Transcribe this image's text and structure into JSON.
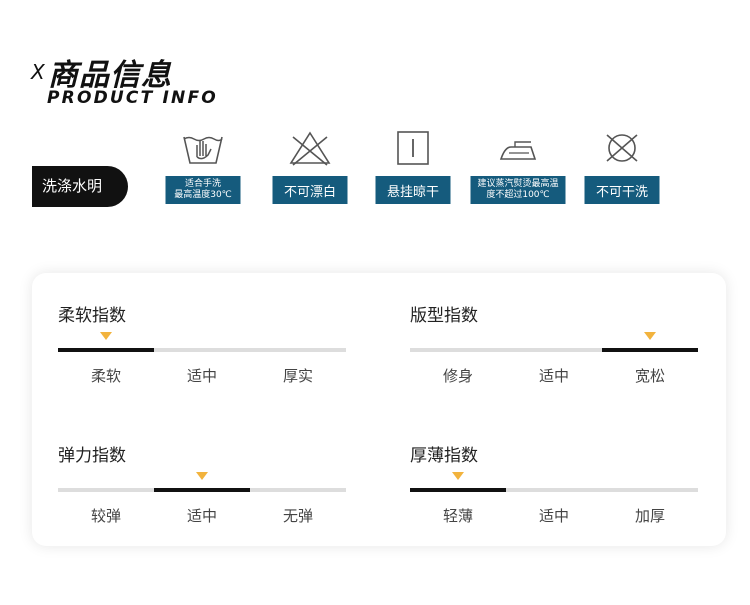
{
  "header": {
    "prefix": "X",
    "title": "商品信息",
    "subtitle": "PRODUCT INFO"
  },
  "washing": {
    "tag": "洗涤水明",
    "items": [
      {
        "icon": "hand-wash-icon",
        "lines": [
          "适合手洗",
          "最高温度30℃"
        ]
      },
      {
        "icon": "no-bleach-icon",
        "lines": [
          "不可漂白"
        ]
      },
      {
        "icon": "hang-dry-icon",
        "lines": [
          "悬挂晾干"
        ]
      },
      {
        "icon": "iron-icon",
        "lines": [
          "建议蒸汽熨烫最高温",
          "度不超过100℃"
        ]
      },
      {
        "icon": "no-dry-clean-icon",
        "lines": [
          "不可干洗"
        ]
      }
    ]
  },
  "indices": [
    {
      "title": "柔软指数",
      "levels": [
        "柔软",
        "适中",
        "厚实"
      ],
      "selected": 0
    },
    {
      "title": "版型指数",
      "levels": [
        "修身",
        "适中",
        "宽松"
      ],
      "selected": 2
    },
    {
      "title": "弹力指数",
      "levels": [
        "较弹",
        "适中",
        "无弹"
      ],
      "selected": 1
    },
    {
      "title": "厚薄指数",
      "levels": [
        "轻薄",
        "适中",
        "加厚"
      ],
      "selected": 0
    }
  ],
  "colors": {
    "accent": "#155b7d",
    "indicator": "#f2b33d",
    "bar_fill": "#111111",
    "bar_track": "#dddddd"
  }
}
